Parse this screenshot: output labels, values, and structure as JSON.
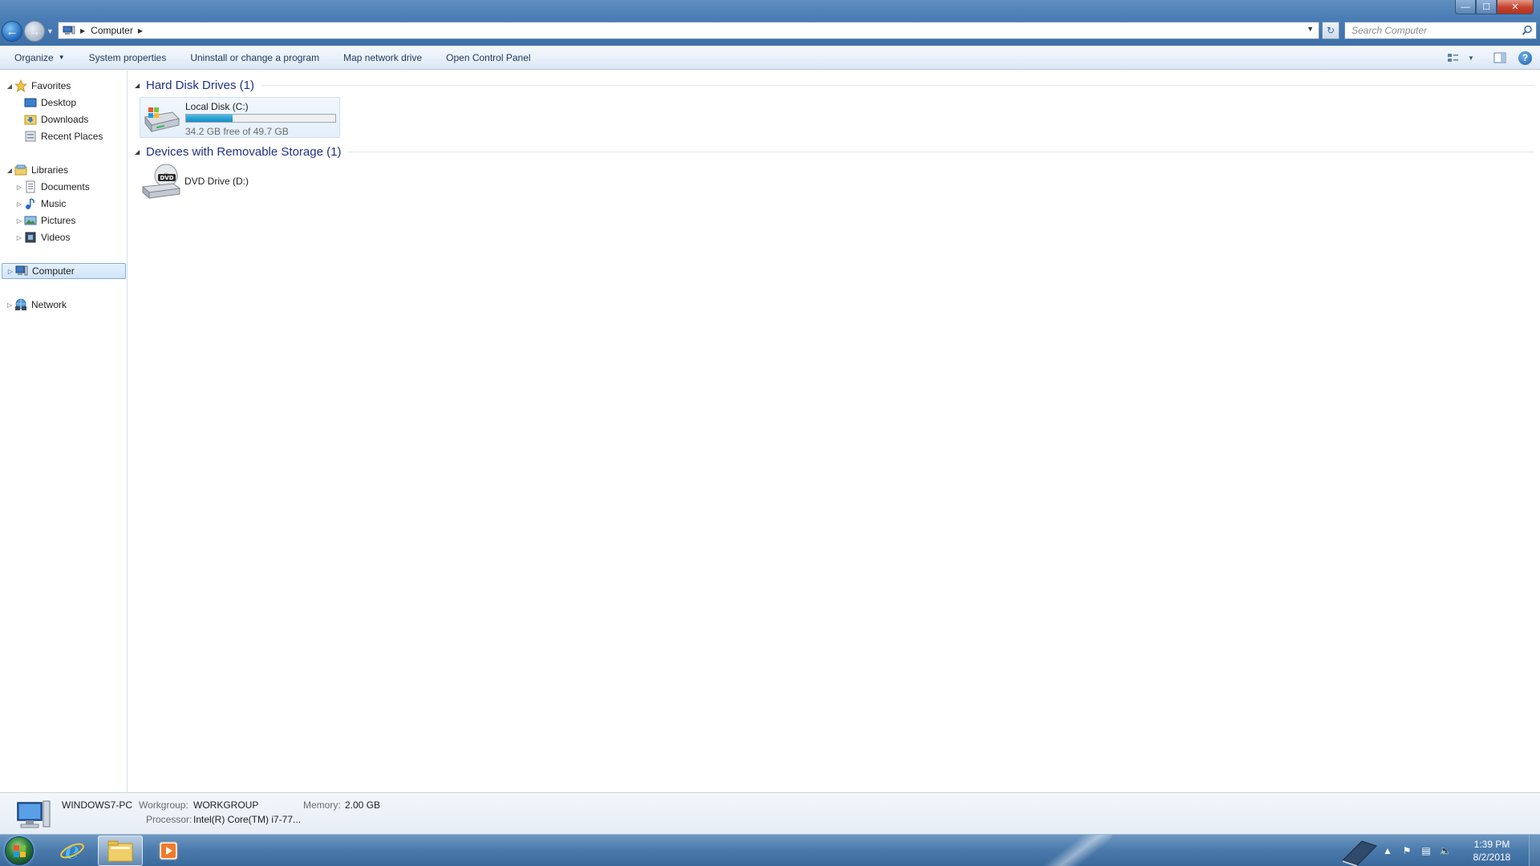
{
  "window": {
    "title": "Computer",
    "controls": {
      "minimize": "—",
      "maximize": "☐",
      "close": "✕"
    }
  },
  "address_bar": {
    "breadcrumb": [
      "Computer"
    ],
    "search_placeholder": "Search Computer"
  },
  "toolbar": {
    "organize": "Organize",
    "system_properties": "System properties",
    "uninstall": "Uninstall or change a program",
    "map_drive": "Map network drive",
    "control_panel": "Open Control Panel"
  },
  "nav": {
    "favorites": "Favorites",
    "desktop": "Desktop",
    "downloads": "Downloads",
    "recent_places": "Recent Places",
    "libraries": "Libraries",
    "documents": "Documents",
    "music": "Music",
    "pictures": "Pictures",
    "videos": "Videos",
    "computer": "Computer",
    "network": "Network"
  },
  "groups": {
    "hard_disk": {
      "title": "Hard Disk Drives (1)",
      "drives": [
        {
          "name": "Local Disk (C:)",
          "free_text": "34.2 GB free of 49.7 GB",
          "used_fraction": 0.312
        }
      ]
    },
    "removable": {
      "title": "Devices with Removable Storage (1)",
      "devices": [
        {
          "name": "DVD Drive (D:)",
          "icon_label": "DVD"
        }
      ]
    }
  },
  "details": {
    "name": "WINDOWS7-PC",
    "workgroup_label": "Workgroup:",
    "workgroup_value": "WORKGROUP",
    "memory_label": "Memory:",
    "memory_value": "2.00 GB",
    "processor_label": "Processor:",
    "processor_value": "Intel(R) Core(TM) i7-77..."
  },
  "taskbar": {
    "time": "1:39 PM",
    "date": "8/2/2018"
  },
  "colors": {
    "accent": "#1e3287",
    "progress": "#27a0d6",
    "title_bar": "#4a7db5"
  }
}
